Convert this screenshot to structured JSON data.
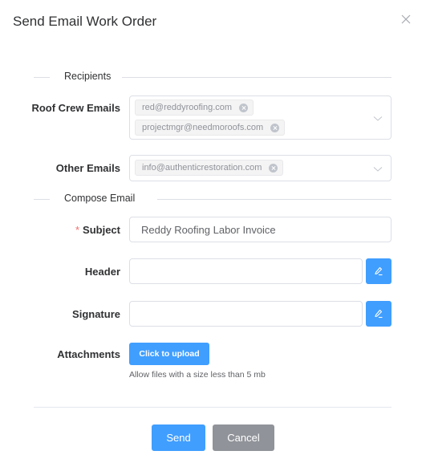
{
  "dialog": {
    "title": "Send Email Work Order",
    "close_icon": "close-icon"
  },
  "sections": {
    "recipients": "Recipients",
    "compose": "Compose Email"
  },
  "fields": {
    "roof_crew": {
      "label": "Roof Crew Emails",
      "tags": [
        "red@reddyroofing.com",
        "projectmgr@needmoroofs.com"
      ]
    },
    "other": {
      "label": "Other Emails",
      "tags": [
        "info@authenticrestoration.com"
      ]
    },
    "subject": {
      "required_mark": "*",
      "label": "Subject",
      "value": "Reddy Roofing Labor Invoice"
    },
    "header": {
      "label": "Header",
      "value": ""
    },
    "signature": {
      "label": "Signature",
      "value": ""
    },
    "attachments": {
      "label": "Attachments",
      "upload_label": "Click to upload",
      "tip": "Allow files with a size less than 5 mb"
    }
  },
  "footer": {
    "send_label": "Send",
    "cancel_label": "Cancel"
  },
  "colors": {
    "primary": "#409eff",
    "cancel": "#909399",
    "required": "#f56c6c"
  }
}
